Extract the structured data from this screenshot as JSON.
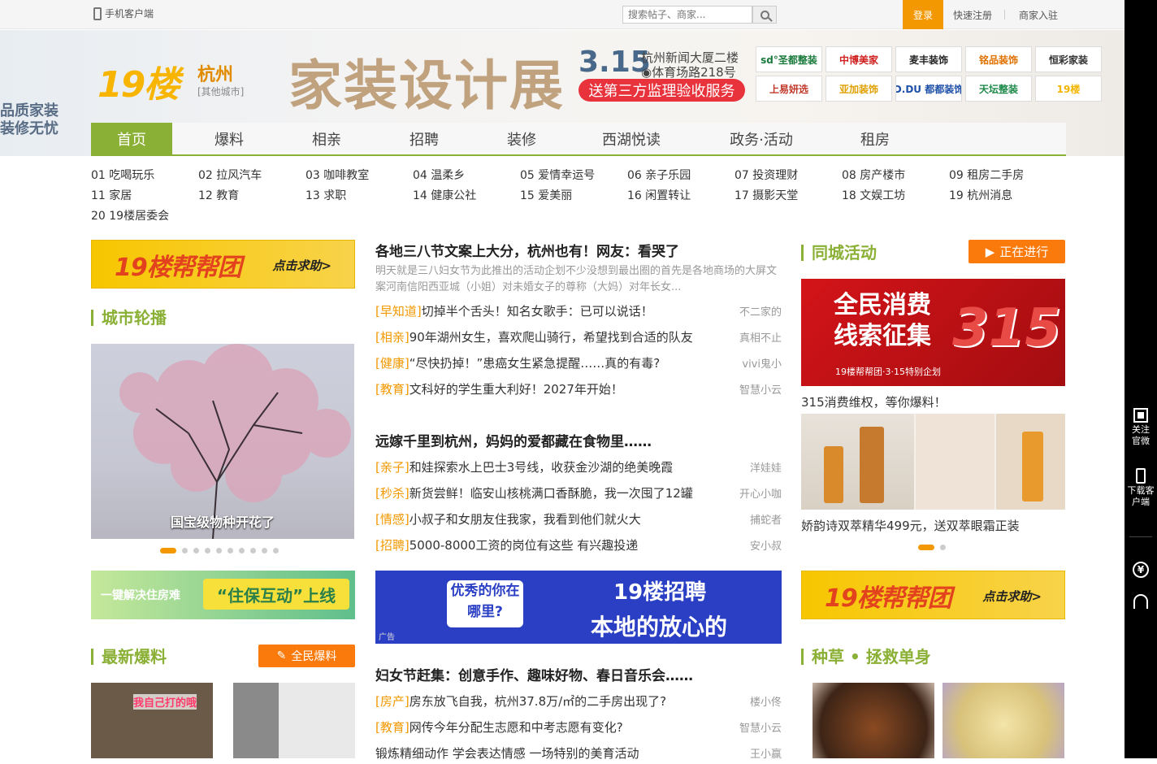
{
  "topbar": {
    "mobile_label": "手机客户端",
    "search_placeholder": "搜索帖子、商家...",
    "login": "登录",
    "register": "快速注册",
    "merchant": "商家入驻"
  },
  "header": {
    "side_promo_1": "品质家装",
    "side_promo_2": "装修无忧",
    "logo": "19楼",
    "city": "杭州",
    "other_city": "[其他城市]",
    "banner_title": "家装设计展",
    "banner_date": "3.15",
    "banner_venue_1": "杭州新闻大厦二楼",
    "banner_venue_2": "◉体育场路218号",
    "banner_slogan": "送第三方监理验收服务",
    "brands": [
      "sd°圣都整装",
      "中博美家",
      "麦丰装饰",
      "铭品装饰",
      "恒彩家装",
      "上易妍选",
      "亚加装饰",
      "D.DU 都都装饰",
      "天坛整装",
      "19楼"
    ]
  },
  "nav": {
    "items": [
      "首页",
      "爆料",
      "相亲",
      "招聘",
      "装修",
      "西湖悦读",
      "政务·活动",
      "租房"
    ]
  },
  "subnav": {
    "items": [
      "01 吃喝玩乐",
      "02 拉风汽车",
      "03 咖啡教室",
      "04 温柔乡",
      "05 爱情幸运号",
      "06 亲子乐园",
      "07 投资理财",
      "08 房产楼市",
      "09 租房二手房",
      "11 家居",
      "12 教育",
      "13 求职",
      "14 健康公社",
      "15 爱美丽",
      "16 闲置转让",
      "17 摄影天堂",
      "18 文娱工坊",
      "19 杭州消息",
      "20 19楼居委会"
    ]
  },
  "left": {
    "help_banner_title": "19楼帮帮团",
    "help_banner_sub": "点击求助>",
    "city_carousel_title": "城市轮播",
    "carousel_caption": "国宝级物种开花了",
    "housing_t1": "一键解决住房难",
    "housing_t2": "“住保互动”上线",
    "latest_title": "最新爆料",
    "latest_btn": "全民爆料",
    "thumb_overlay": "我自己打的哦"
  },
  "middle": {
    "headline_1": "各地三八节文案上大分，杭州也有！网友：看哭了",
    "summary_1": "明天就是三八妇女节为此推出的活动企划不少没想到最出圈的首先是各地商场的大屏文案河南信阳西亚城（小姐）对未婚女子的尊称（大妈）对年长女...",
    "news_1": [
      {
        "tag": "[早知道]",
        "title": "切掉半个舌头！知名女歌手：已可以说话！",
        "author": "不二家的"
      },
      {
        "tag": "[相亲]",
        "title": "90年湖州女生，喜欢爬山骑行，希望找到合适的队友",
        "author": "真相不止"
      },
      {
        "tag": "[健康]",
        "title": "“尽快扔掉！”患癌女生紧急提醒……真的有毒?",
        "author": "vivi鬼小"
      },
      {
        "tag": "[教育]",
        "title": "文科好的学生重大利好！2027年开始！",
        "author": "智慧小云"
      }
    ],
    "headline_2": "远嫁千里到杭州，妈妈的爱都藏在食物里……",
    "news_2": [
      {
        "tag": "[亲子]",
        "title": "和娃探索水上巴士3号线，收获金沙湖的绝美晚霞",
        "author": "洋娃娃"
      },
      {
        "tag": "[秒杀]",
        "title": "新货尝鲜！临安山核桃满口香酥脆，我一次囤了12罐",
        "author": "开心小咖"
      },
      {
        "tag": "[情感]",
        "title": "小叔子和女朋友住我家，我看到他们就火大",
        "author": "捕蛇者"
      },
      {
        "tag": "[招聘]",
        "title": "5000-8000工资的岗位有这些 有兴趣投递",
        "author": "安小叔"
      }
    ],
    "recruit_1": "19楼招聘",
    "recruit_2": "本地的放心的",
    "recruit_bubble": "优秀的你在哪里?",
    "recruit_ad": "广告",
    "headline_3": "妇女节赶集：创意手作、趣味好物、春日音乐会……",
    "news_3": [
      {
        "tag": "[房产]",
        "title": "房东放飞自我，杭州37.8万/㎡的二手房出现了?",
        "author": "楼小佟"
      },
      {
        "tag": "[教育]",
        "title": "网传今年分配生志愿和中考志愿有变化?",
        "author": "智慧小云"
      },
      {
        "tag": "",
        "title": "锻炼精细动作 学会表达情感 一场特别的美育活动",
        "author": "王小赢"
      }
    ]
  },
  "right": {
    "activity_title": "同城活动",
    "activity_btn": "正在进行",
    "promo_line_1": "全民消费",
    "promo_line_2": "线索征集",
    "promo_num": "315",
    "promo_sub": "19楼帮帮团·3·15特别企划",
    "promo_caption": "315消费维权，等你爆料！",
    "product_caption": "娇韵诗双萃精华499元，送双萃眼霜正装",
    "help_banner_title": "19楼帮帮团",
    "help_banner_sub": "点击求助>",
    "grass_title": "种草 • 拯救单身"
  },
  "sidebar": {
    "follow": "关注官微",
    "download": "下载客户端",
    "yen": "¥"
  },
  "colors": {
    "accent_green": "#8bb036",
    "accent_orange": "#f39800",
    "tag_orange": "#f39800"
  }
}
